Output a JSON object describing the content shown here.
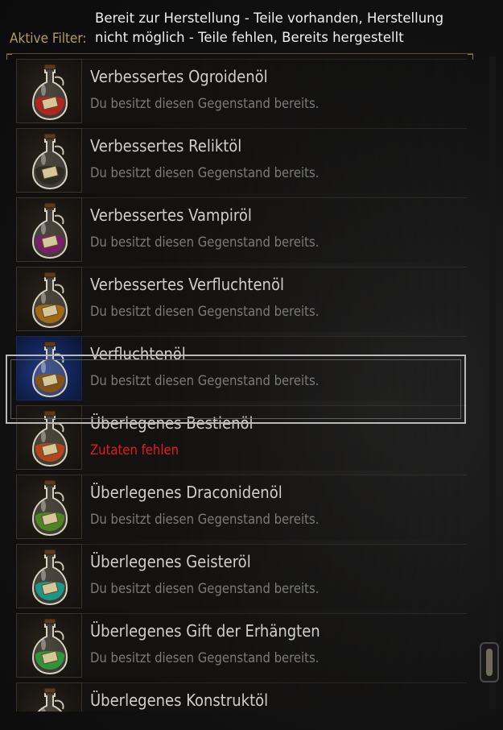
{
  "filters": {
    "label": "Aktive Filter:",
    "text": "Bereit zur Herstellung - Teile vorhanden, Herstellung nicht möglich - Teile fehlen, Bereits hergestellt"
  },
  "items": [
    {
      "name": "Verbessertes Ogroidenöl",
      "status": "Du besitzt diesen Gegenstand bereits.",
      "icon": "oil-flask-icon",
      "liquid": "#b8231d"
    },
    {
      "name": "Verbessertes Reliktöl",
      "status": "Du besitzt diesen Gegenstand bereits.",
      "icon": "oil-flask-icon",
      "liquid": "#2c2a22"
    },
    {
      "name": "Verbessertes Vampiröl",
      "status": "Du besitzt diesen Gegenstand bereits.",
      "icon": "oil-flask-icon",
      "liquid": "#7e1f6a"
    },
    {
      "name": "Verbessertes Verfluchtenöl",
      "status": "Du besitzt diesen Gegenstand bereits.",
      "icon": "oil-flask-icon",
      "liquid": "#a86a14"
    },
    {
      "name": "Verfluchtenöl",
      "status": "Du besitzt diesen Gegenstand bereits.",
      "icon": "oil-flask-icon",
      "liquid": "#8a5312"
    },
    {
      "name": "Überlegenes Bestienöl",
      "status": "Zutaten fehlen",
      "icon": "oil-flask-icon",
      "liquid": "#b9461b"
    },
    {
      "name": "Überlegenes Draconidenöl",
      "status": "Du besitzt diesen Gegenstand bereits.",
      "icon": "oil-flask-icon",
      "liquid": "#4c8a22"
    },
    {
      "name": "Überlegenes Geisteröl",
      "status": "Du besitzt diesen Gegenstand bereits.",
      "icon": "oil-flask-icon",
      "liquid": "#1b9a8c"
    },
    {
      "name": "Überlegenes Gift der Erhängten",
      "status": "Du besitzt diesen Gegenstand bereits.",
      "icon": "oil-flask-icon",
      "liquid": "#2f9a3a"
    },
    {
      "name": "Überlegenes Konstruktöl",
      "status": "",
      "icon": "oil-flask-icon",
      "liquid": "#3a5e8a"
    }
  ],
  "colors": {
    "filter_label": "#b59a6a",
    "missing_ingredients": "#e21d1d",
    "owned_status": "#7b7b7b"
  }
}
